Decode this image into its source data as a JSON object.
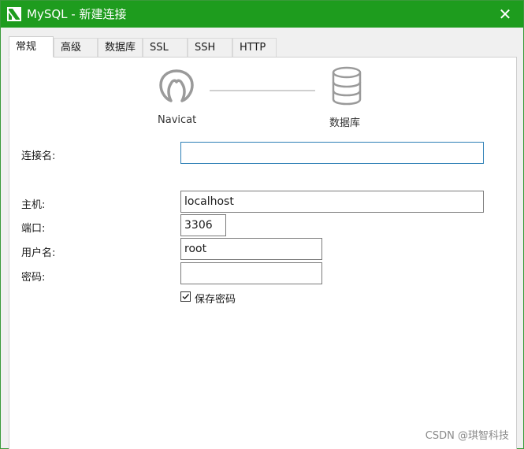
{
  "window": {
    "title": "MySQL - 新建连接",
    "close_glyph": "✕",
    "title_bar_color": "#1e9c1e",
    "app_icon": "navicat-dolphin-icon"
  },
  "tabs": [
    {
      "label": "常规",
      "active": true
    },
    {
      "label": "高级",
      "active": false
    },
    {
      "label": "数据库",
      "active": false
    },
    {
      "label": "SSL",
      "active": false
    },
    {
      "label": "SSH",
      "active": false
    },
    {
      "label": "HTTP",
      "active": false
    }
  ],
  "diagram": {
    "left_label": "Navicat",
    "right_label": "数据库",
    "left_icon": "navicat-logo-icon",
    "right_icon": "database-icon"
  },
  "form": {
    "connection_name": {
      "label": "连接名:",
      "value": ""
    },
    "host": {
      "label": "主机:",
      "value": "localhost"
    },
    "port": {
      "label": "端口:",
      "value": "3306"
    },
    "username": {
      "label": "用户名:",
      "value": "root"
    },
    "password": {
      "label": "密码:",
      "value": ""
    },
    "save_password": {
      "label": "保存密码",
      "checked": true
    }
  },
  "watermark": "CSDN @琪智科技"
}
